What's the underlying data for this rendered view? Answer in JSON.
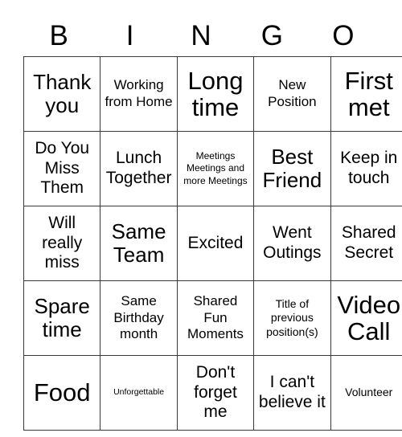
{
  "card": {
    "headers": [
      "B",
      "I",
      "N",
      "G",
      "O"
    ],
    "rows": [
      [
        {
          "text": "Thank you",
          "size": "t-xl"
        },
        {
          "text": "Working from Home",
          "size": "t-md"
        },
        {
          "text": "Long time",
          "size": "t-xxl"
        },
        {
          "text": "New Position",
          "size": "t-md"
        },
        {
          "text": "First met",
          "size": "t-xxl"
        }
      ],
      [
        {
          "text": "Do You Miss Them",
          "size": "t-lg"
        },
        {
          "text": "Lunch Together",
          "size": "t-lg"
        },
        {
          "text": "Meetings Meetings and more Meetings",
          "size": "t-xs"
        },
        {
          "text": "Best Friend",
          "size": "t-xl"
        },
        {
          "text": "Keep in touch",
          "size": "t-lg"
        }
      ],
      [
        {
          "text": "Will really miss",
          "size": "t-lg"
        },
        {
          "text": "Same Team",
          "size": "t-xl"
        },
        {
          "text": "Excited",
          "size": "t-lg"
        },
        {
          "text": "Went Outings",
          "size": "t-lg"
        },
        {
          "text": "Shared Secret",
          "size": "t-lg"
        }
      ],
      [
        {
          "text": "Spare time",
          "size": "t-xl"
        },
        {
          "text": "Same Birthday month",
          "size": "t-md"
        },
        {
          "text": "Shared Fun Moments",
          "size": "t-md"
        },
        {
          "text": "Title of previous position(s)",
          "size": "t-sm"
        },
        {
          "text": "Video Call",
          "size": "t-xxl"
        }
      ],
      [
        {
          "text": "Food",
          "size": "t-xxl"
        },
        {
          "text": "Unforgettable",
          "size": "t-xxs"
        },
        {
          "text": "Don't forget me",
          "size": "t-lg"
        },
        {
          "text": "I can't believe it",
          "size": "t-lg"
        },
        {
          "text": "Volunteer",
          "size": "t-sm"
        }
      ]
    ]
  }
}
